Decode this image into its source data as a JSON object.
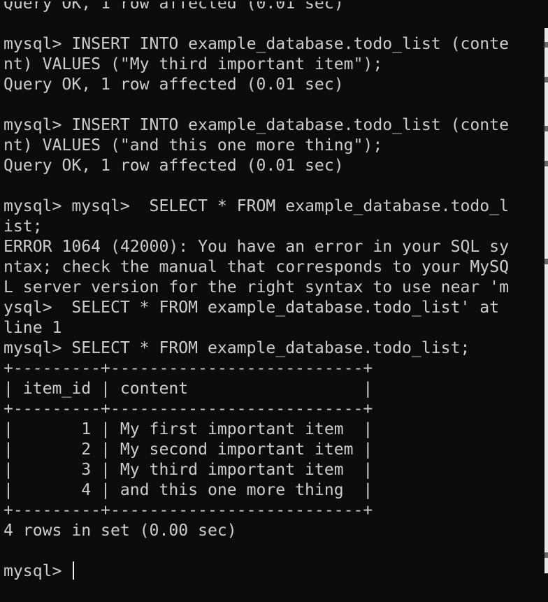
{
  "terminal": {
    "lines": [
      "Query OK, 1 row affected (0.01 sec)",
      "",
      "mysql> INSERT INTO example_database.todo_list (conte",
      "nt) VALUES (\"My third important item\");",
      "Query OK, 1 row affected (0.01 sec)",
      "",
      "mysql> INSERT INTO example_database.todo_list (conte",
      "nt) VALUES (\"and this one more thing\");",
      "Query OK, 1 row affected (0.01 sec)",
      "",
      "mysql> mysql>  SELECT * FROM example_database.todo_l",
      "ist;",
      "ERROR 1064 (42000): You have an error in your SQL sy",
      "ntax; check the manual that corresponds to your MySQ",
      "L server version for the right syntax to use near 'm",
      "ysql>  SELECT * FROM example_database.todo_list' at",
      "line 1",
      "mysql> SELECT * FROM example_database.todo_list;",
      "+---------+--------------------------+",
      "| item_id | content                  |",
      "+---------+--------------------------+",
      "|       1 | My first important item  |",
      "|       2 | My second important item |",
      "|       3 | My third important item  |",
      "|       4 | and this one more thing  |",
      "+---------+--------------------------+",
      "4 rows in set (0.00 sec)",
      "",
      "mysql> "
    ]
  },
  "colors": {
    "background": "#0c0c0c",
    "foreground": "#cccccc",
    "cursor": "#f0f0f0"
  }
}
